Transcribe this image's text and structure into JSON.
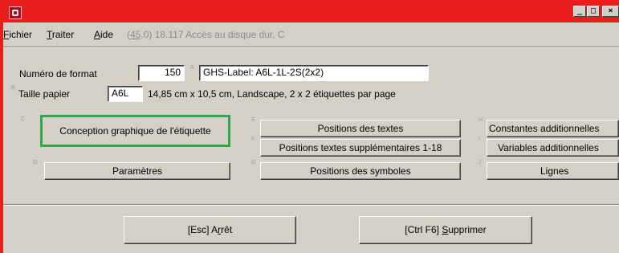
{
  "colors": {
    "titlebar": "#ea1c1c",
    "focus_border": "#2da84a",
    "window_bg": "#d4d0c8"
  },
  "window": {
    "icon": "app-icon",
    "minimize_glyph": "_",
    "maximize_glyph": "□",
    "close_glyph": "×"
  },
  "menu": {
    "fichier_first": "F",
    "fichier_rest": "ichier",
    "traiter_first": "T",
    "traiter_rest": "raiter",
    "aide_first": "A",
    "aide_rest": "ide",
    "info_before": "(",
    "info_underlined": "45",
    "info_after": ".0) 18.117 Accès au disque dur, C"
  },
  "format": {
    "label": "Numéro de format",
    "number": "150",
    "marker_a": "A",
    "label_value": "GHS-Label: A6L-1L-2S(2x2)"
  },
  "paper": {
    "marker_b": "B",
    "label": "Taille papier",
    "value": "A6L",
    "description": "14,85 cm x 10,5 cm, Landscape, 2 x 2 étiquettes par page"
  },
  "buttons": {
    "marker_c": "C",
    "conception": "Conception graphique de l'étiquette",
    "marker_d": "D",
    "parametres": "Paramètres",
    "marker_e": "E",
    "positions_textes": "Positions des textes",
    "marker_f": "F",
    "positions_textes_supp": "Positions textes supplémentaires 1-18",
    "marker_g": "G",
    "positions_symboles": "Positions des symboles",
    "marker_h": "H",
    "constantes": "Constantes additionnelles",
    "marker_i": "I",
    "variables": "Variables additionnelles",
    "marker_j": "J",
    "lignes": "Lignes"
  },
  "footer": {
    "stop_prefix": "[Esc] A",
    "stop_underlined": "r",
    "stop_suffix": "rêt",
    "delete_prefix": "[Ctrl F6] ",
    "delete_underlined": "S",
    "delete_suffix": "upprimer"
  }
}
